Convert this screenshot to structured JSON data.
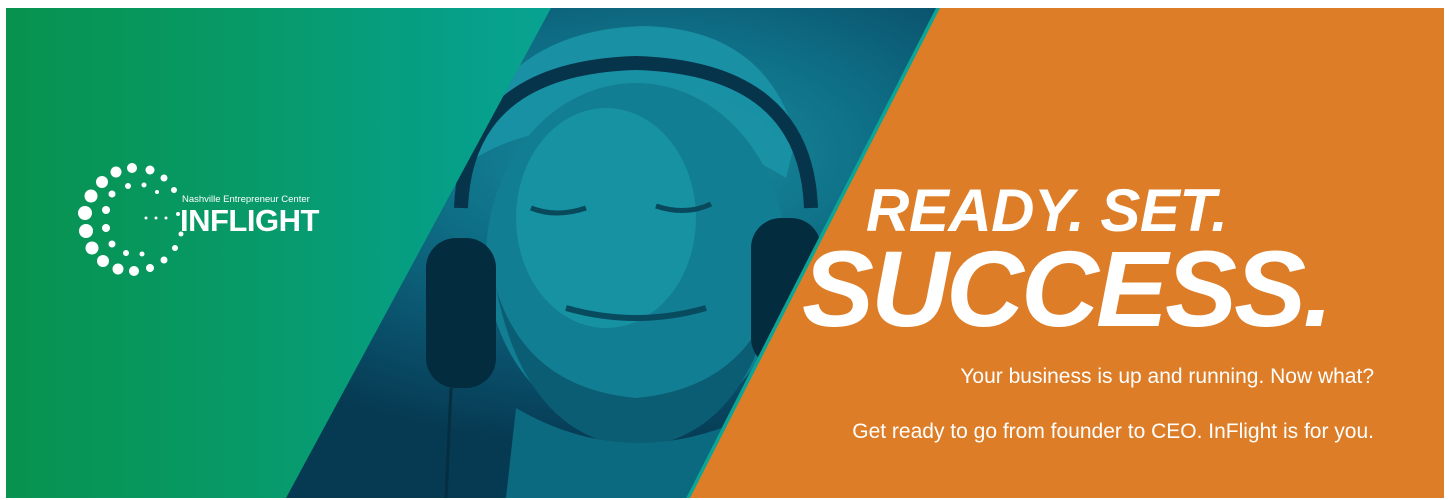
{
  "banner": {
    "brand": {
      "org_name": "Nashville Entrepreneur Center",
      "program_name": "INFLIGHT",
      "logo_icon": "dotted-ring-icon"
    },
    "headline_line1": "READY. SET.",
    "headline_line2": "SUCCESS.",
    "subline1": "Your business is up and running. Now what?",
    "subline2": "Get ready to go from founder to CEO. InFlight is for you.",
    "photo": "man-with-headphones-image",
    "colors": {
      "green": "#07924e",
      "teal": "#0aa596",
      "orange": "#dd7d27",
      "text": "#ffffff"
    }
  }
}
